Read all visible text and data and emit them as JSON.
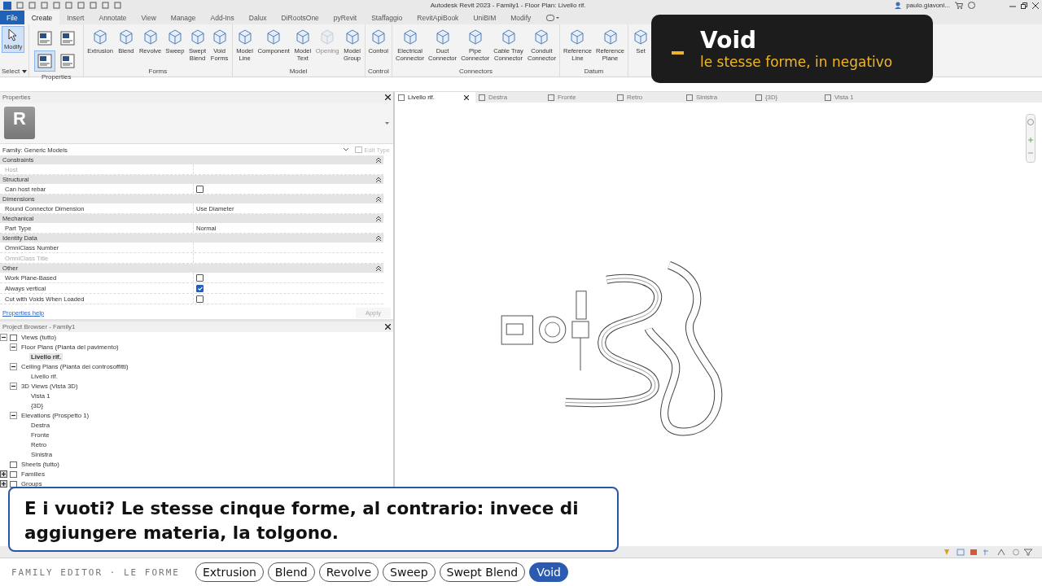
{
  "title_bar": {
    "title": "Autodesk Revit 2023 - Family1 - Floor Plan: Livello rif.",
    "user": "paulo.giavoni..."
  },
  "ribbon_tabs": [
    {
      "label": "File",
      "kind": "file",
      "selected": false
    },
    {
      "label": "Create",
      "kind": "tab",
      "selected": true
    },
    {
      "label": "Insert",
      "kind": "tab",
      "selected": false
    },
    {
      "label": "Annotate",
      "kind": "tab",
      "selected": false
    },
    {
      "label": "View",
      "kind": "tab",
      "selected": false
    },
    {
      "label": "Manage",
      "kind": "tab",
      "selected": false
    },
    {
      "label": "Add-Ins",
      "kind": "tab",
      "selected": false
    },
    {
      "label": "Dalux",
      "kind": "tab",
      "selected": false
    },
    {
      "label": "DiRootsOne",
      "kind": "tab",
      "selected": false
    },
    {
      "label": "pyRevit",
      "kind": "tab",
      "selected": false
    },
    {
      "label": "Staffaggio",
      "kind": "tab",
      "selected": false
    },
    {
      "label": "RevitApiBook",
      "kind": "tab",
      "selected": false
    },
    {
      "label": "UniBIM",
      "kind": "tab",
      "selected": false
    },
    {
      "label": "Modify",
      "kind": "tab",
      "selected": false
    }
  ],
  "ribbon_panels": [
    {
      "kind": "select",
      "title": "Select",
      "buttons": [
        {
          "label": "Modify",
          "selected": true
        }
      ]
    },
    {
      "kind": "icons",
      "title": "Properties",
      "buttons": [
        {
          "selected": false
        },
        {
          "selected": false
        },
        {
          "selected": true
        },
        {
          "selected": false
        }
      ]
    },
    {
      "kind": "tools",
      "title": "Forms",
      "buttons": [
        {
          "label": "Extrusion",
          "disabled": false
        },
        {
          "label": "Blend",
          "disabled": false
        },
        {
          "label": "Revolve",
          "disabled": false
        },
        {
          "label": "Sweep",
          "disabled": false
        },
        {
          "label": "Swept\nBlend",
          "disabled": false
        },
        {
          "label": "Void\nForms",
          "disabled": false
        }
      ]
    },
    {
      "kind": "tools",
      "title": "Model",
      "buttons": [
        {
          "label": "Model\nLine",
          "disabled": false
        },
        {
          "label": "Component",
          "disabled": false
        },
        {
          "label": "Model\nText",
          "disabled": false
        },
        {
          "label": "Opening",
          "disabled": true
        },
        {
          "label": "Model\nGroup",
          "disabled": false
        }
      ]
    },
    {
      "kind": "tools",
      "title": "Control",
      "buttons": [
        {
          "label": "Control",
          "disabled": false
        }
      ]
    },
    {
      "kind": "tools",
      "title": "Connectors",
      "buttons": [
        {
          "label": "Electrical\nConnector",
          "disabled": false
        },
        {
          "label": "Duct\nConnector",
          "disabled": false
        },
        {
          "label": "Pipe\nConnector",
          "disabled": false
        },
        {
          "label": "Cable Tray\nConnector",
          "disabled": false
        },
        {
          "label": "Conduit\nConnector",
          "disabled": false
        }
      ]
    },
    {
      "kind": "tools",
      "title": "Datum",
      "buttons": [
        {
          "label": "Reference\nLine",
          "disabled": false
        },
        {
          "label": "Reference\nPlane",
          "disabled": false
        }
      ]
    },
    {
      "kind": "tools",
      "buttons": [
        {
          "label": "Set",
          "disabled": false
        }
      ]
    }
  ],
  "callout": {
    "title": "Void",
    "subtitle": "le stesse forme, in negativo"
  },
  "properties": {
    "title": "Properties",
    "type_image_label": "R",
    "type_selector": "Family: Generic Models",
    "edit_type": "Edit Type",
    "groups": [
      {
        "name": "Constraints",
        "expanded": true,
        "rows": [
          {
            "name": "Host",
            "kind": "text",
            "disabled": true
          }
        ]
      },
      {
        "name": "Structural",
        "expanded": true,
        "rows": [
          {
            "name": "Can host rebar",
            "kind": "checkbox",
            "checked": false,
            "disabled": false
          }
        ]
      },
      {
        "name": "Dimensions",
        "expanded": true,
        "rows": [
          {
            "name": "Round Connector Dimension",
            "kind": "text",
            "value": "Use Diameter",
            "disabled": false
          }
        ]
      },
      {
        "name": "Mechanical",
        "expanded": true,
        "rows": [
          {
            "name": "Part Type",
            "kind": "text",
            "value": "Normal",
            "disabled": false
          }
        ]
      },
      {
        "name": "Identity Data",
        "expanded": true,
        "rows": [
          {
            "name": "OmniClass Number",
            "kind": "text",
            "disabled": false
          },
          {
            "name": "OmniClass Title",
            "kind": "text",
            "disabled": true
          }
        ]
      },
      {
        "name": "Other",
        "expanded": true,
        "rows": [
          {
            "name": "Work Plane-Based",
            "kind": "checkbox",
            "checked": false,
            "disabled": false
          },
          {
            "name": "Always vertical",
            "kind": "checkbox",
            "checked": true,
            "disabled": false
          },
          {
            "name": "Cut with Voids When Loaded",
            "kind": "checkbox",
            "checked": false,
            "disabled": false
          }
        ]
      }
    ],
    "help_link": "Properties help",
    "apply": "Apply"
  },
  "project_browser": {
    "title": "Project Browser - Family1",
    "tree": [
      {
        "label": "Views (tutto)",
        "expanded": true,
        "selected": false,
        "children": [
          {
            "label": "Floor Plans (Pianta del pavimento)",
            "expanded": true,
            "selected": false,
            "children": [
              {
                "label": "Livello rif.",
                "selected": true
              }
            ]
          },
          {
            "label": "Ceiling Plans (Pianta dei controsoffitti)",
            "expanded": true,
            "selected": false,
            "children": [
              {
                "label": "Livello rif.",
                "selected": false
              }
            ]
          },
          {
            "label": "3D Views (Vista 3D)",
            "expanded": true,
            "selected": false,
            "children": [
              {
                "label": "Vista 1",
                "selected": false
              },
              {
                "label": "{3D}",
                "selected": false
              }
            ]
          },
          {
            "label": "Elevations (Prospetto 1)",
            "expanded": true,
            "selected": false,
            "children": [
              {
                "label": "Destra",
                "selected": false
              },
              {
                "label": "Fronte",
                "selected": false
              },
              {
                "label": "Retro",
                "selected": false
              },
              {
                "label": "Sinistra",
                "selected": false
              }
            ]
          }
        ]
      },
      {
        "label": "Sheets (tutto)",
        "selected": false
      },
      {
        "label": "Families",
        "expanded": false,
        "selected": false
      },
      {
        "label": "Groups",
        "expanded": false,
        "selected": false
      }
    ]
  },
  "view_tabs": [
    {
      "label": "Livello rif.",
      "selected": true
    },
    {
      "label": "Destra",
      "selected": false
    },
    {
      "label": "Fronte",
      "selected": false
    },
    {
      "label": "Retro",
      "selected": false
    },
    {
      "label": "Sinistra",
      "selected": false
    },
    {
      "label": "{3D}",
      "selected": false
    },
    {
      "label": "Vista 1",
      "selected": false
    }
  ],
  "caption": "E i vuoti? Le stesse cinque forme, al contrario: invece di aggiungere materia, la tolgono.",
  "lesson_bar": {
    "title": "FAMILY EDITOR · LE FORME",
    "chips": [
      {
        "label": "Extrusion",
        "selected": false
      },
      {
        "label": "Blend",
        "selected": false
      },
      {
        "label": "Revolve",
        "selected": false
      },
      {
        "label": "Sweep",
        "selected": false
      },
      {
        "label": "Swept Blend",
        "selected": false
      },
      {
        "label": "Void",
        "selected": true
      }
    ]
  }
}
